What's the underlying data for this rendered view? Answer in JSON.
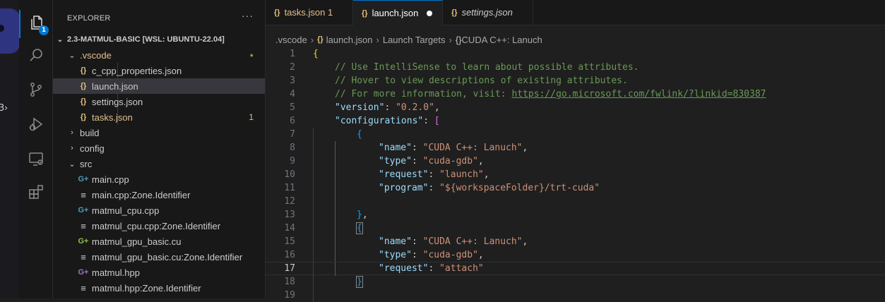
{
  "sidebar": {
    "title": "EXPLORER",
    "more": "···",
    "root": "2.3-MATMUL-BASIC [WSL: UBUNTU-22.04]",
    "badge": "1",
    "items": [
      {
        "label": ".vscode",
        "kind": "folder-open",
        "color": "#e2c08d",
        "suffix": "●"
      },
      {
        "label": "c_cpp_properties.json",
        "kind": "json",
        "color": "#cccccc",
        "icon": "{}"
      },
      {
        "label": "launch.json",
        "kind": "json",
        "color": "#cccccc",
        "icon": "{}"
      },
      {
        "label": "settings.json",
        "kind": "json",
        "color": "#cccccc",
        "icon": "{}"
      },
      {
        "label": "tasks.json",
        "kind": "json",
        "color": "#e2c08d",
        "icon": "{}",
        "suffix": "1"
      },
      {
        "label": "build",
        "kind": "folder",
        "color": "#cccccc"
      },
      {
        "label": "config",
        "kind": "folder",
        "color": "#cccccc"
      },
      {
        "label": "src",
        "kind": "folder-open",
        "color": "#cccccc"
      },
      {
        "label": "main.cpp",
        "kind": "cpp",
        "color": "#cccccc",
        "icon": "G+"
      },
      {
        "label": "main.cpp:Zone.Identifier",
        "kind": "text",
        "color": "#cccccc",
        "icon": "≡"
      },
      {
        "label": "matmul_cpu.cpp",
        "kind": "cpp",
        "color": "#cccccc",
        "icon": "G+"
      },
      {
        "label": "matmul_cpu.cpp:Zone.Identifier",
        "kind": "text",
        "color": "#cccccc",
        "icon": "≡"
      },
      {
        "label": "matmul_gpu_basic.cu",
        "kind": "cu",
        "color": "#cccccc",
        "icon": "G+"
      },
      {
        "label": "matmul_gpu_basic.cu:Zone.Identifier",
        "kind": "text",
        "color": "#cccccc",
        "icon": "≡"
      },
      {
        "label": "matmul.hpp",
        "kind": "hpp",
        "color": "#cccccc",
        "icon": "G+"
      },
      {
        "label": "matmul.hpp:Zone.Identifier",
        "kind": "text",
        "color": "#cccccc",
        "icon": "≡"
      }
    ]
  },
  "tabs": [
    {
      "label": "tasks.json 1",
      "active": false,
      "color": "#e2c08d",
      "italic": false
    },
    {
      "label": "launch.json",
      "active": true,
      "color": "#ffffff",
      "italic": false
    },
    {
      "label": "settings.json",
      "active": false,
      "color": "#cccccc",
      "italic": true
    }
  ],
  "breadcrumb": {
    "parts": [
      ".vscode",
      "launch.json",
      "Launch Targets",
      "CUDA C++: Lanuch"
    ]
  },
  "editor": {
    "current_line": 17,
    "lines": [
      {
        "n": "1",
        "indent": 0,
        "tokens": [
          {
            "t": "{",
            "c": "c-b1"
          }
        ]
      },
      {
        "n": "2",
        "indent": 1,
        "tokens": [
          {
            "t": "// Use IntelliSense to learn about possible attributes.",
            "c": "c-cm"
          }
        ]
      },
      {
        "n": "3",
        "indent": 1,
        "tokens": [
          {
            "t": "// Hover to view descriptions of existing attributes.",
            "c": "c-cm"
          }
        ]
      },
      {
        "n": "4",
        "indent": 1,
        "tokens": [
          {
            "t": "// For more information, visit: ",
            "c": "c-cm"
          },
          {
            "t": "https://go.microsoft.com/fwlink/?linkid=830387",
            "c": "c-cm-link"
          }
        ]
      },
      {
        "n": "5",
        "indent": 1,
        "tokens": [
          {
            "t": "\"version\"",
            "c": "c-key"
          },
          {
            "t": ": ",
            "c": "c-p"
          },
          {
            "t": "\"0.2.0\"",
            "c": "c-str"
          },
          {
            "t": ",",
            "c": "c-p"
          }
        ]
      },
      {
        "n": "6",
        "indent": 1,
        "tokens": [
          {
            "t": "\"configurations\"",
            "c": "c-key"
          },
          {
            "t": ": ",
            "c": "c-p"
          },
          {
            "t": "[",
            "c": "c-b2"
          }
        ]
      },
      {
        "n": "7",
        "indent": 2,
        "tokens": [
          {
            "t": "{",
            "c": "c-b3"
          }
        ]
      },
      {
        "n": "8",
        "indent": 3,
        "tokens": [
          {
            "t": "\"name\"",
            "c": "c-key"
          },
          {
            "t": ": ",
            "c": "c-p"
          },
          {
            "t": "\"CUDA C++: Lanuch\"",
            "c": "c-str"
          },
          {
            "t": ",",
            "c": "c-p"
          }
        ]
      },
      {
        "n": "9",
        "indent": 3,
        "tokens": [
          {
            "t": "\"type\"",
            "c": "c-key"
          },
          {
            "t": ": ",
            "c": "c-p"
          },
          {
            "t": "\"cuda-gdb\"",
            "c": "c-str"
          },
          {
            "t": ",",
            "c": "c-p"
          }
        ]
      },
      {
        "n": "10",
        "indent": 3,
        "tokens": [
          {
            "t": "\"request\"",
            "c": "c-key"
          },
          {
            "t": ": ",
            "c": "c-p"
          },
          {
            "t": "\"launch\"",
            "c": "c-str"
          },
          {
            "t": ",",
            "c": "c-p"
          }
        ]
      },
      {
        "n": "11",
        "indent": 3,
        "tokens": [
          {
            "t": "\"program\"",
            "c": "c-key"
          },
          {
            "t": ": ",
            "c": "c-p"
          },
          {
            "t": "\"${workspaceFolder}/trt-cuda\"",
            "c": "c-str"
          }
        ]
      },
      {
        "n": "12",
        "indent": 0,
        "tokens": []
      },
      {
        "n": "13",
        "indent": 2,
        "tokens": [
          {
            "t": "}",
            "c": "c-b3"
          },
          {
            "t": ",",
            "c": "c-p"
          }
        ]
      },
      {
        "n": "14",
        "indent": 2,
        "tokens": [
          {
            "t": "{",
            "c": "c-b3-match"
          }
        ]
      },
      {
        "n": "15",
        "indent": 3,
        "tokens": [
          {
            "t": "\"name\"",
            "c": "c-key"
          },
          {
            "t": ": ",
            "c": "c-p"
          },
          {
            "t": "\"CUDA C++: Lanuch\"",
            "c": "c-str"
          },
          {
            "t": ",",
            "c": "c-p"
          }
        ]
      },
      {
        "n": "16",
        "indent": 3,
        "tokens": [
          {
            "t": "\"type\"",
            "c": "c-key"
          },
          {
            "t": ": ",
            "c": "c-p"
          },
          {
            "t": "\"cuda-gdb\"",
            "c": "c-str"
          },
          {
            "t": ",",
            "c": "c-p"
          }
        ]
      },
      {
        "n": "17",
        "indent": 3,
        "tokens": [
          {
            "t": "\"request\"",
            "c": "c-key"
          },
          {
            "t": ": ",
            "c": "c-p"
          },
          {
            "t": "\"attach\"",
            "c": "c-str"
          }
        ]
      },
      {
        "n": "18",
        "indent": 2,
        "tokens": [
          {
            "t": "}",
            "c": "c-b3-match"
          }
        ]
      },
      {
        "n": "19",
        "indent": 0,
        "tokens": []
      }
    ]
  },
  "icons": {
    "explorer": "files-icon",
    "search": "search-icon",
    "source_control": "source-control-icon",
    "run_debug": "run-debug-icon",
    "remote": "remote-explorer-icon",
    "extensions": "extensions-icon"
  },
  "colors": {
    "accent": "#0078d4",
    "modified": "#e2c08d"
  }
}
